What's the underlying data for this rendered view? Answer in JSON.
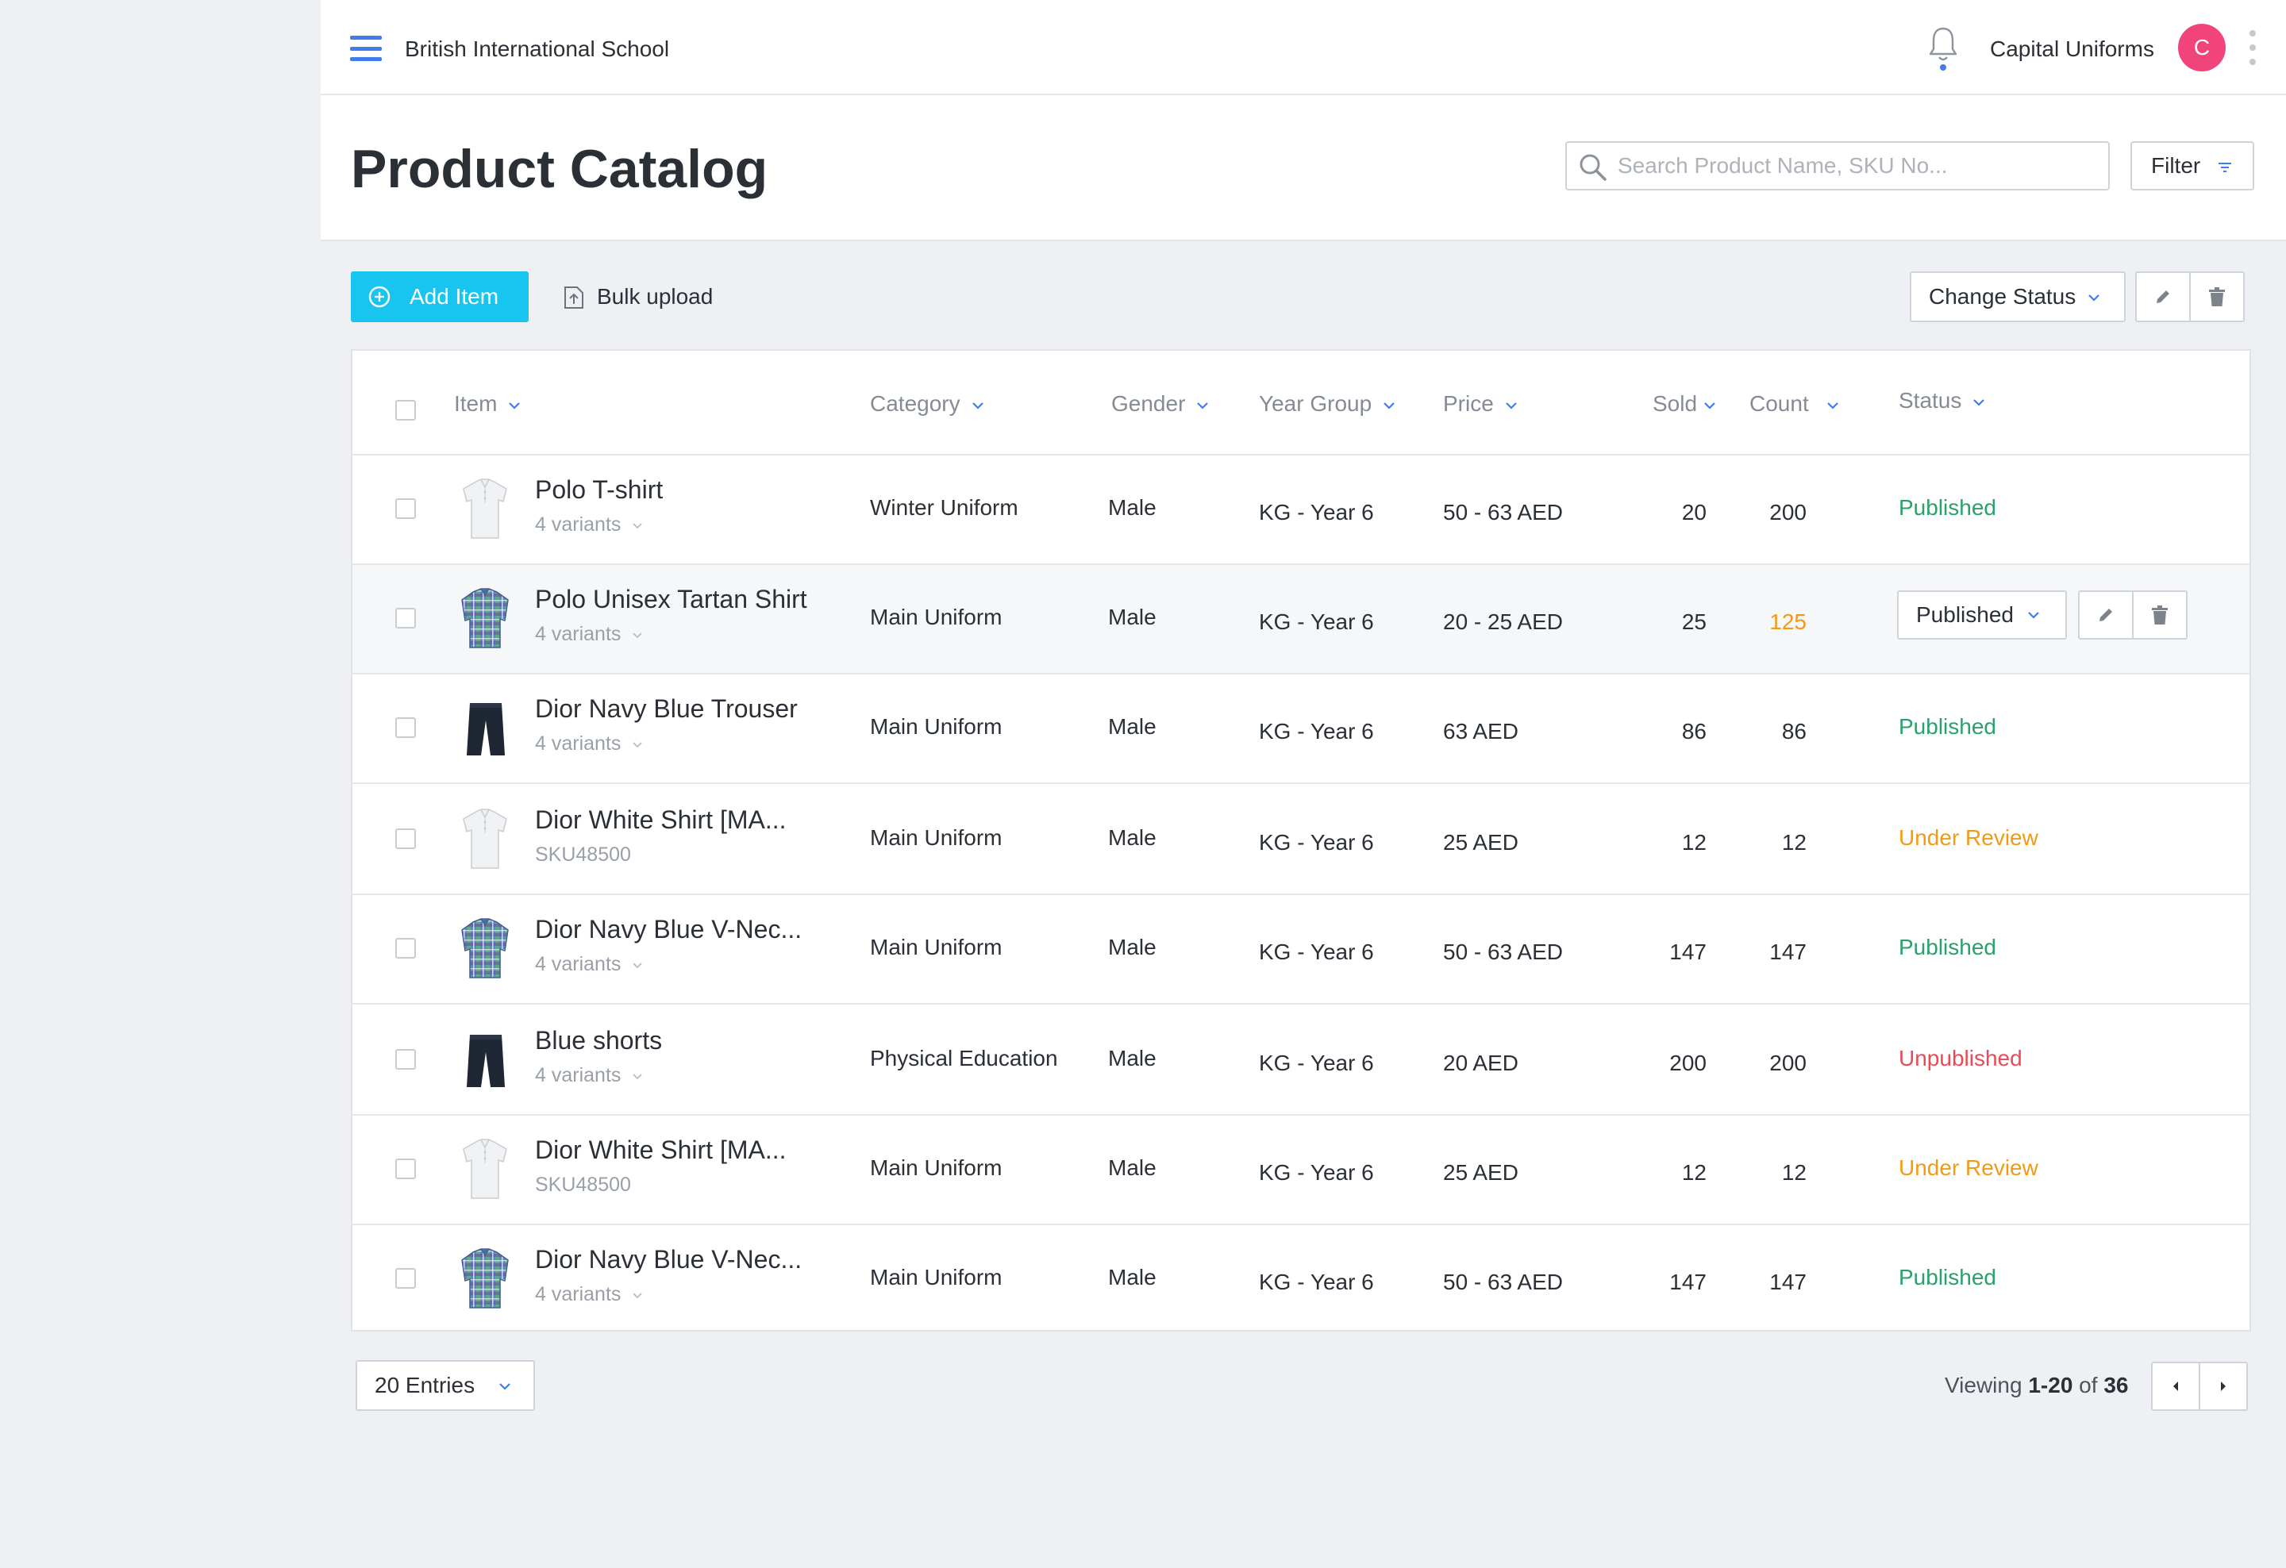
{
  "topbar": {
    "school_name": "British International School",
    "account_name": "Capital Uniforms",
    "avatar_initial": "C"
  },
  "page": {
    "title": "Product Catalog",
    "search_placeholder": "Search Product Name, SKU No...",
    "filter_label": "Filter"
  },
  "toolbar": {
    "add_label": "Add Item",
    "bulk_label": "Bulk upload",
    "change_status_label": "Change Status"
  },
  "table": {
    "columns": {
      "item": "Item",
      "category": "Category",
      "gender": "Gender",
      "year_group": "Year Group",
      "price": "Price",
      "sold": "Sold",
      "count": "Count",
      "status": "Status"
    },
    "rows": [
      {
        "name": "Polo T-shirt",
        "sub": "4 variants",
        "image": "white-shirt",
        "category": "Winter Uniform",
        "gender": "Male",
        "year_group": "KG - Year 6",
        "price": "50 - 63 AED",
        "sold": "20",
        "count": "200",
        "status": "Published"
      },
      {
        "name": "Polo Unisex Tartan Shirt",
        "sub": "4 variants",
        "image": "tartan-shirt",
        "category": "Main Uniform",
        "gender": "Male",
        "year_group": "KG - Year 6",
        "price": "20 - 25 AED",
        "sold": "25",
        "count": "125",
        "status": "Published"
      },
      {
        "name": "Dior Navy Blue Trouser",
        "sub": "4 variants",
        "image": "navy-shorts",
        "category": "Main Uniform",
        "gender": "Male",
        "year_group": "KG - Year 6",
        "price": "63 AED",
        "sold": "86",
        "count": "86",
        "status": "Published"
      },
      {
        "name": "Dior White Shirt [MA...",
        "sub": "SKU48500",
        "image": "white-shirt",
        "category": "Main Uniform",
        "gender": "Male",
        "year_group": "KG - Year 6",
        "price": "25 AED",
        "sold": "12",
        "count": "12",
        "status": "Under Review"
      },
      {
        "name": "Dior Navy Blue V-Nec...",
        "sub": "4 variants",
        "image": "tartan-shirt",
        "category": "Main Uniform",
        "gender": "Male",
        "year_group": "KG - Year 6",
        "price": "50 - 63 AED",
        "sold": "147",
        "count": "147",
        "status": "Published"
      },
      {
        "name": "Blue shorts",
        "sub": "4 variants",
        "image": "navy-shorts",
        "category": "Physical Education",
        "gender": "Male",
        "year_group": "KG - Year 6",
        "price": "20 AED",
        "sold": "200",
        "count": "200",
        "status": "Unpublished"
      },
      {
        "name": "Dior White Shirt [MA...",
        "sub": "SKU48500",
        "image": "white-shirt",
        "category": "Main Uniform",
        "gender": "Male",
        "year_group": "KG - Year 6",
        "price": "25 AED",
        "sold": "12",
        "count": "12",
        "status": "Under Review"
      },
      {
        "name": "Dior Navy Blue V-Nec...",
        "sub": "4 variants",
        "image": "tartan-shirt",
        "category": "Main Uniform",
        "gender": "Male",
        "year_group": "KG - Year 6",
        "price": "50 - 63 AED",
        "sold": "147",
        "count": "147",
        "status": "Published"
      }
    ]
  },
  "footer": {
    "entries_label": "20 Entries",
    "viewing_prefix": "Viewing",
    "viewing_range": "1-20",
    "viewing_of": "of",
    "viewing_total": "36"
  },
  "colors": {
    "accent": "#3f7de8",
    "add_button": "#18c5ef",
    "avatar": "#f0447a",
    "published": "#2aa16a",
    "under_review": "#f39a14",
    "unpublished": "#ea4a58"
  }
}
